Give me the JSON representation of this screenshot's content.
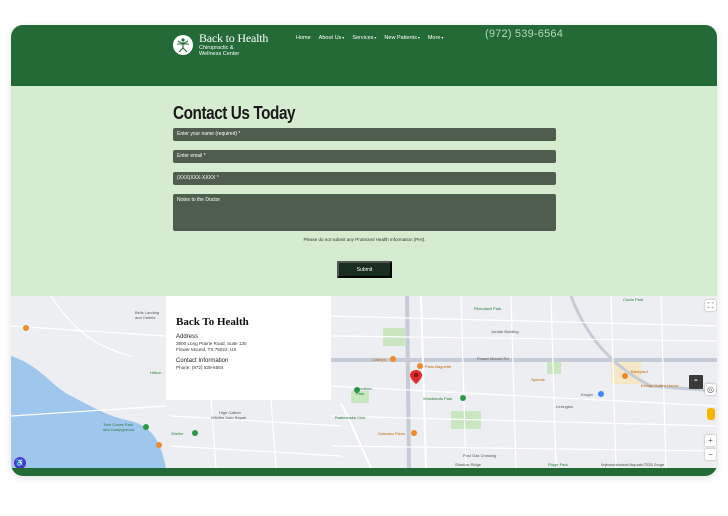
{
  "header": {
    "logo": {
      "title": "Back to Health",
      "subtitle_line1": "Chiropractic &",
      "subtitle_line2": "Wellness Center"
    },
    "nav": [
      {
        "label": "Home",
        "has_caret": false
      },
      {
        "label": "About Us",
        "has_caret": true
      },
      {
        "label": "Services",
        "has_caret": true
      },
      {
        "label": "New Patients",
        "has_caret": true
      },
      {
        "label": "More",
        "has_caret": true
      }
    ],
    "phone": "(972) 539-6564"
  },
  "contact": {
    "title": "Contact Us Today",
    "fields": {
      "name_placeholder": "Enter your name (required) *",
      "email_placeholder": "Enter email *",
      "phone_placeholder": "(XXX)XXX-XXXX *",
      "notes_placeholder": "Notes to the Doctor"
    },
    "privacy_note": "Please do not submit any Protected Health Information (PHI).",
    "submit_label": "Submit"
  },
  "map": {
    "card": {
      "name": "Back To Health",
      "address_heading": "Address",
      "address_line1": "3900 Long Prairie Road, Suite 130",
      "address_line2": "Flower Mound, TX 75022, US",
      "contact_heading": "Contact Information",
      "phone_line": "Phone: (972) 539-6564"
    },
    "labels": {
      "bells_landing": "Bells Landing",
      "and_outlets": "and Outlets",
      "hillcrest": "Hillcre...",
      "twin_coves": "Twin Coves Park",
      "campground": "and Campground",
      "shelter": "Shelter",
      "high_caliber": "High Caliber",
      "auto_repair": "Wildfire Auto Repair",
      "mcmillen": "McMillen",
      "park": "Park",
      "rattlesnake": "Rattlesnake Club",
      "cutley": "Cutley's",
      "paris_baguette": "Paris Baguette",
      "woodlands_park": "Woodlands Park",
      "doinatsu": "Doinatsu Pizza",
      "rheudasil": "Rheudasil Park",
      "sprouts": "Sprouts",
      "kroger": "Kroger",
      "lexington": "Lexington",
      "elrings": "Elrings Coffee House",
      "backyard": "Backyard",
      "flower_mound_rd": "Flower Mound Rd",
      "jordan": "Jordan Building",
      "clovis": "Clovis Park",
      "ridge": "Ridge Park",
      "post_oak": "Post Oak Crossing",
      "shadow_ridge": "Shadow Ridge",
      "attribution": "Keyboard shortcuts   Map data ©2025 Google"
    }
  }
}
